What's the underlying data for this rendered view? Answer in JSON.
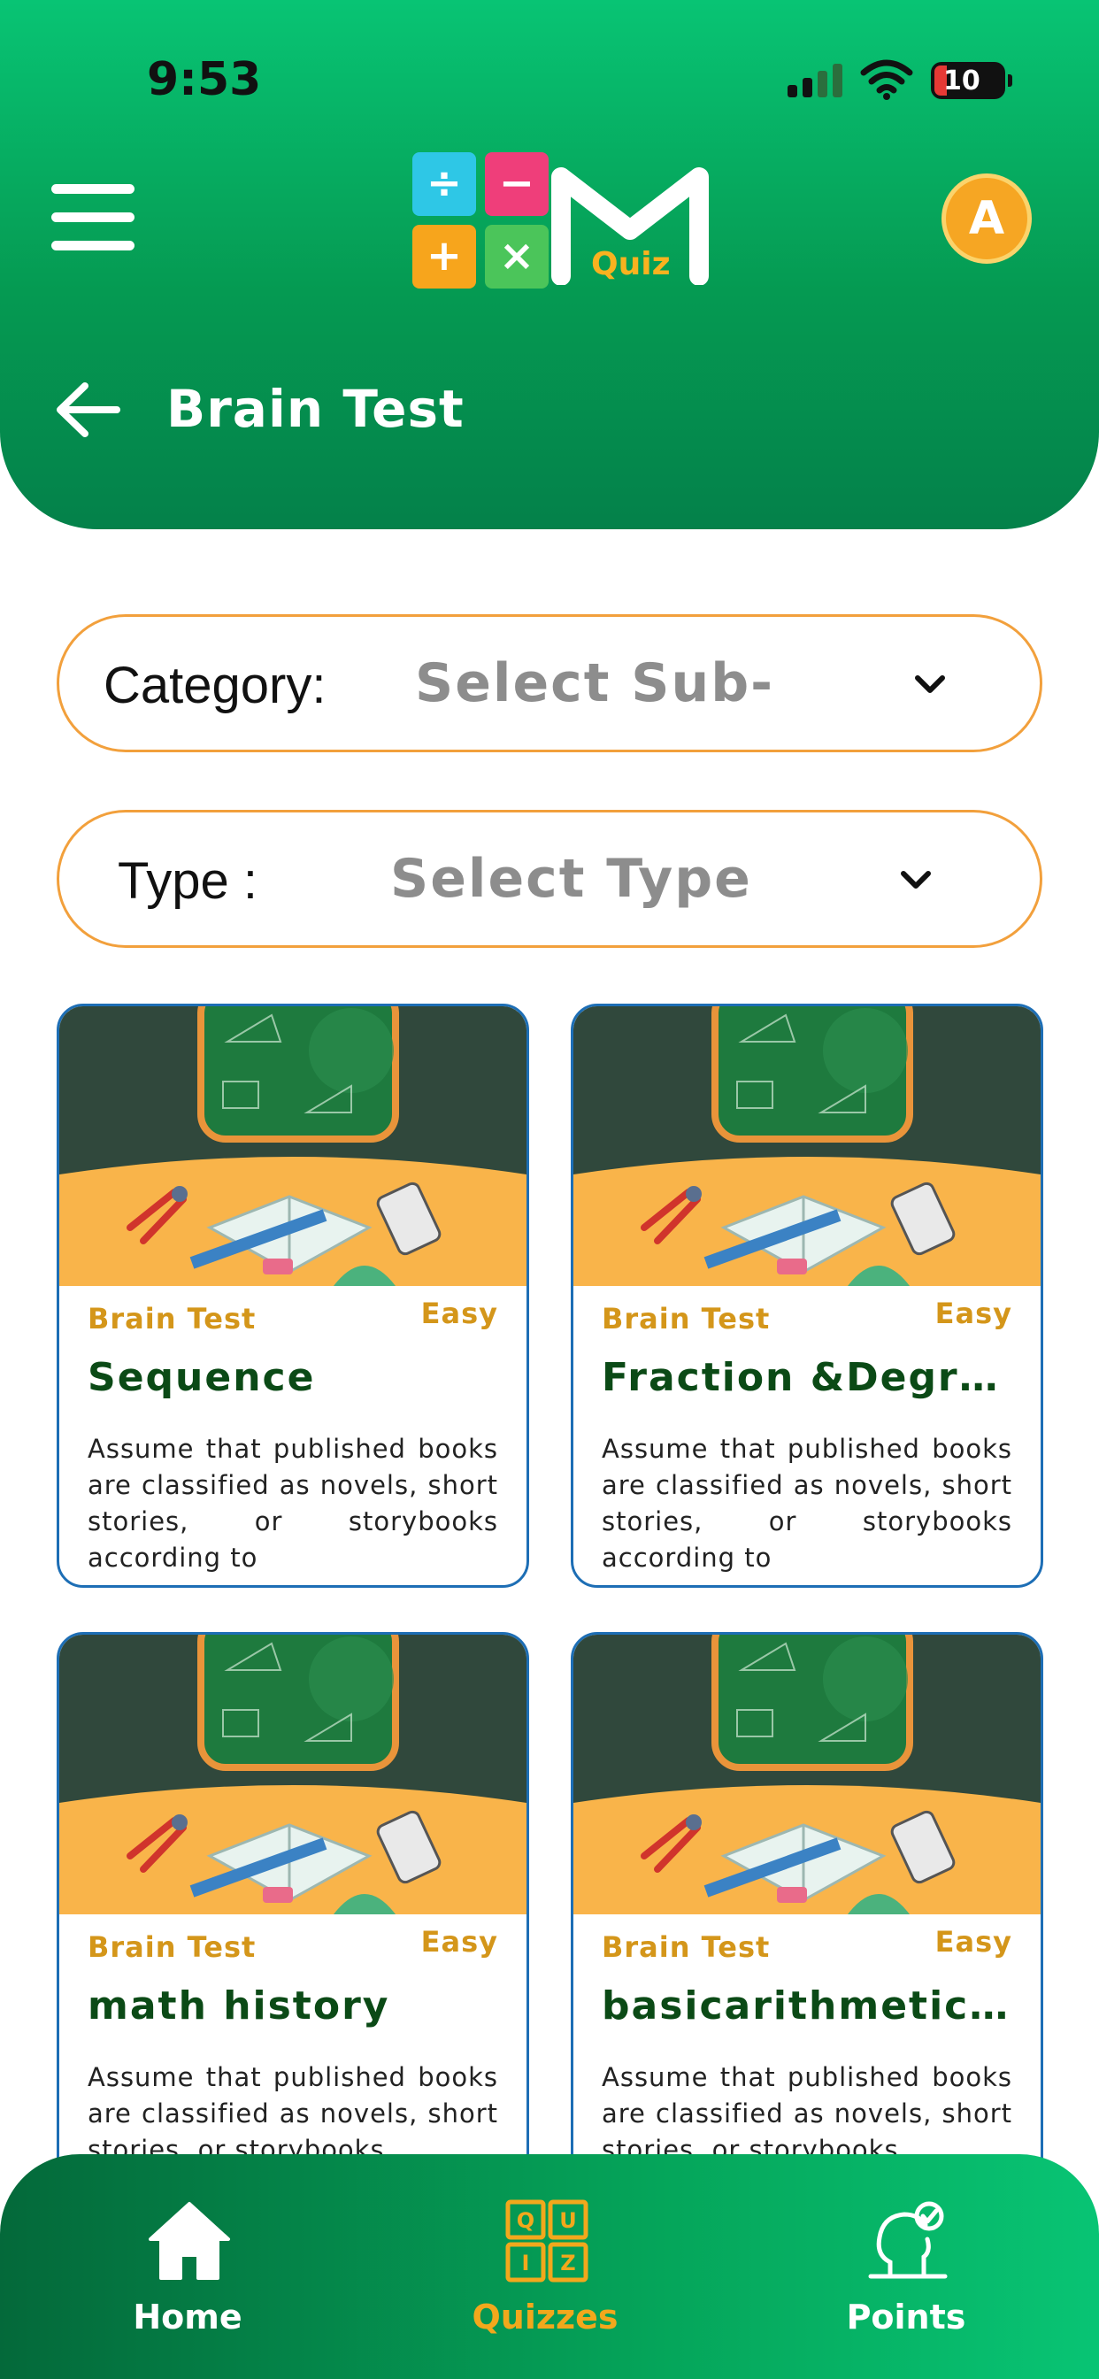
{
  "status_bar": {
    "time": "9:53",
    "battery": "10"
  },
  "header": {
    "logo_text": "Quiz",
    "avatar_initial": "A",
    "page_title": "Brain Test"
  },
  "filters": {
    "category": {
      "label": "Category:",
      "value": "Select Sub-"
    },
    "type": {
      "label": "Type  :",
      "value": "Select Type"
    }
  },
  "cards": [
    {
      "category": "Brain Test",
      "level": "Easy",
      "title": "Sequence",
      "description": "Assume that published books are classified as novels, short stories, or storybooks according to"
    },
    {
      "category": "Brain Test",
      "level": "Easy",
      "title": "Fraction &Degrees",
      "description": "Assume that published books are classified as novels, short stories, or storybooks according to"
    },
    {
      "category": "Brain Test",
      "level": "Easy",
      "title": "math history",
      "description": "Assume that published books are classified as novels, short stories, or storybooks"
    },
    {
      "category": "Brain Test",
      "level": "Easy",
      "title": "basicarithmetic op...",
      "description": "Assume that published books are classified as novels, short stories, or storybooks"
    }
  ],
  "bottom_nav": {
    "items": [
      {
        "label": "Home",
        "icon": "home-icon"
      },
      {
        "label": "Quizzes",
        "icon": "quiz-grid-icon",
        "active": true
      },
      {
        "label": "Points",
        "icon": "profile-check-icon"
      }
    ]
  },
  "colors": {
    "primary_green": "#059a52",
    "accent_orange": "#f2a03c",
    "card_border": "#1d6eb5",
    "title_green": "#0b4a16",
    "label_gold": "#d4961a"
  }
}
